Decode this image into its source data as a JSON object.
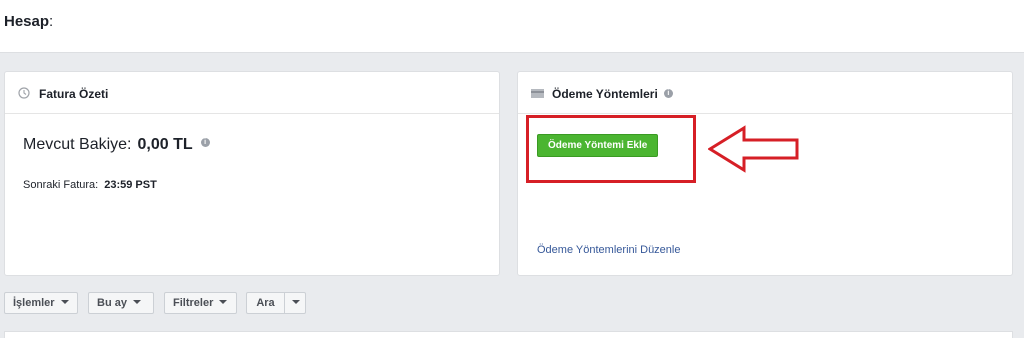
{
  "header": {
    "account_label": "Hesap",
    "account_colon": ":"
  },
  "billing_summary": {
    "title": "Fatura Özeti",
    "icon": "clock-icon",
    "balance_label": "Mevcut Bakiye:",
    "balance_value": "0,00 TL",
    "next_invoice_label": "Sonraki Fatura:",
    "next_invoice_value": "23:59 PST"
  },
  "payment_methods": {
    "title": "Ödeme Yöntemleri",
    "icon": "credit-card-icon",
    "add_button_label": "Ödeme Yöntemi Ekle",
    "edit_link_label": "Ödeme Yöntemlerini Düzenle"
  },
  "filters": {
    "transactions_label": "İşlemler",
    "period_label": "Bu ay",
    "filters_label": "Filtreler",
    "search_label": "Ara"
  },
  "colors": {
    "add_button": "#4bb531",
    "highlight": "#d61f26",
    "link": "#365899",
    "page_background": "#e9ebee"
  }
}
